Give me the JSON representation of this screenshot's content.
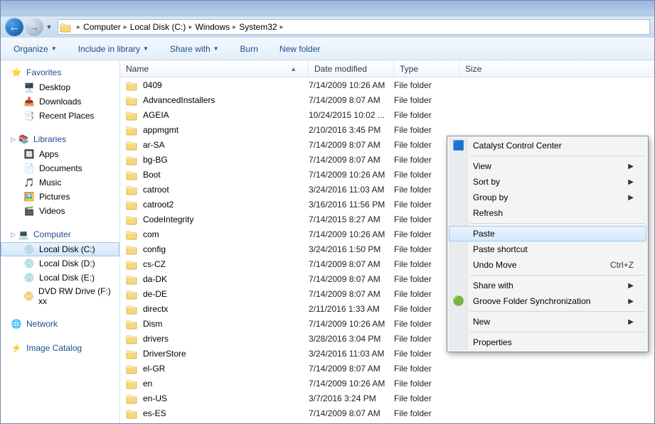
{
  "breadcrumb": [
    "Computer",
    "Local Disk (C:)",
    "Windows",
    "System32"
  ],
  "toolbar": {
    "organize": "Organize",
    "include": "Include in library",
    "share": "Share with",
    "burn": "Burn",
    "newfolder": "New folder"
  },
  "columns": {
    "name": "Name",
    "date": "Date modified",
    "type": "Type",
    "size": "Size"
  },
  "sidebar": {
    "favorites": {
      "label": "Favorites",
      "items": [
        {
          "label": "Desktop"
        },
        {
          "label": "Downloads"
        },
        {
          "label": "Recent Places"
        }
      ]
    },
    "libraries": {
      "label": "Libraries",
      "items": [
        {
          "label": "Apps"
        },
        {
          "label": "Documents"
        },
        {
          "label": "Music"
        },
        {
          "label": "Pictures"
        },
        {
          "label": "Videos"
        }
      ]
    },
    "computer": {
      "label": "Computer",
      "items": [
        {
          "label": "Local Disk (C:)",
          "sel": true
        },
        {
          "label": "Local Disk (D:)"
        },
        {
          "label": "Local Disk (E:)"
        },
        {
          "label": "DVD RW Drive (F:) xx"
        }
      ]
    },
    "network": {
      "label": "Network"
    },
    "catalog": {
      "label": "Image Catalog"
    }
  },
  "files": [
    {
      "name": "0409",
      "date": "7/14/2009 10:26 AM",
      "type": "File folder"
    },
    {
      "name": "AdvancedInstallers",
      "date": "7/14/2009 8:07 AM",
      "type": "File folder"
    },
    {
      "name": "AGEIA",
      "date": "10/24/2015 10:02 ...",
      "type": "File folder"
    },
    {
      "name": "appmgmt",
      "date": "2/10/2016 3:45 PM",
      "type": "File folder"
    },
    {
      "name": "ar-SA",
      "date": "7/14/2009 8:07 AM",
      "type": "File folder"
    },
    {
      "name": "bg-BG",
      "date": "7/14/2009 8:07 AM",
      "type": "File folder"
    },
    {
      "name": "Boot",
      "date": "7/14/2009 10:26 AM",
      "type": "File folder"
    },
    {
      "name": "catroot",
      "date": "3/24/2016 11:03 AM",
      "type": "File folder"
    },
    {
      "name": "catroot2",
      "date": "3/16/2016 11:56 PM",
      "type": "File folder"
    },
    {
      "name": "CodeIntegrity",
      "date": "7/14/2015 8:27 AM",
      "type": "File folder"
    },
    {
      "name": "com",
      "date": "7/14/2009 10:26 AM",
      "type": "File folder"
    },
    {
      "name": "config",
      "date": "3/24/2016 1:50 PM",
      "type": "File folder"
    },
    {
      "name": "cs-CZ",
      "date": "7/14/2009 8:07 AM",
      "type": "File folder"
    },
    {
      "name": "da-DK",
      "date": "7/14/2009 8:07 AM",
      "type": "File folder"
    },
    {
      "name": "de-DE",
      "date": "7/14/2009 8:07 AM",
      "type": "File folder"
    },
    {
      "name": "directx",
      "date": "2/11/2016 1:33 AM",
      "type": "File folder"
    },
    {
      "name": "Dism",
      "date": "7/14/2009 10:26 AM",
      "type": "File folder"
    },
    {
      "name": "drivers",
      "date": "3/28/2016 3:04 PM",
      "type": "File folder"
    },
    {
      "name": "DriverStore",
      "date": "3/24/2016 11:03 AM",
      "type": "File folder"
    },
    {
      "name": "el-GR",
      "date": "7/14/2009 8:07 AM",
      "type": "File folder"
    },
    {
      "name": "en",
      "date": "7/14/2009 10:26 AM",
      "type": "File folder"
    },
    {
      "name": "en-US",
      "date": "3/7/2016 3:24 PM",
      "type": "File folder"
    },
    {
      "name": "es-ES",
      "date": "7/14/2009 8:07 AM",
      "type": "File folder"
    }
  ],
  "context": {
    "ccc": "Catalyst Control Center",
    "view": "View",
    "sort": "Sort by",
    "group": "Group by",
    "refresh": "Refresh",
    "paste": "Paste",
    "pastesc": "Paste shortcut",
    "undo": "Undo Move",
    "undokey": "Ctrl+Z",
    "share": "Share with",
    "groove": "Groove Folder Synchronization",
    "new": "New",
    "props": "Properties"
  }
}
